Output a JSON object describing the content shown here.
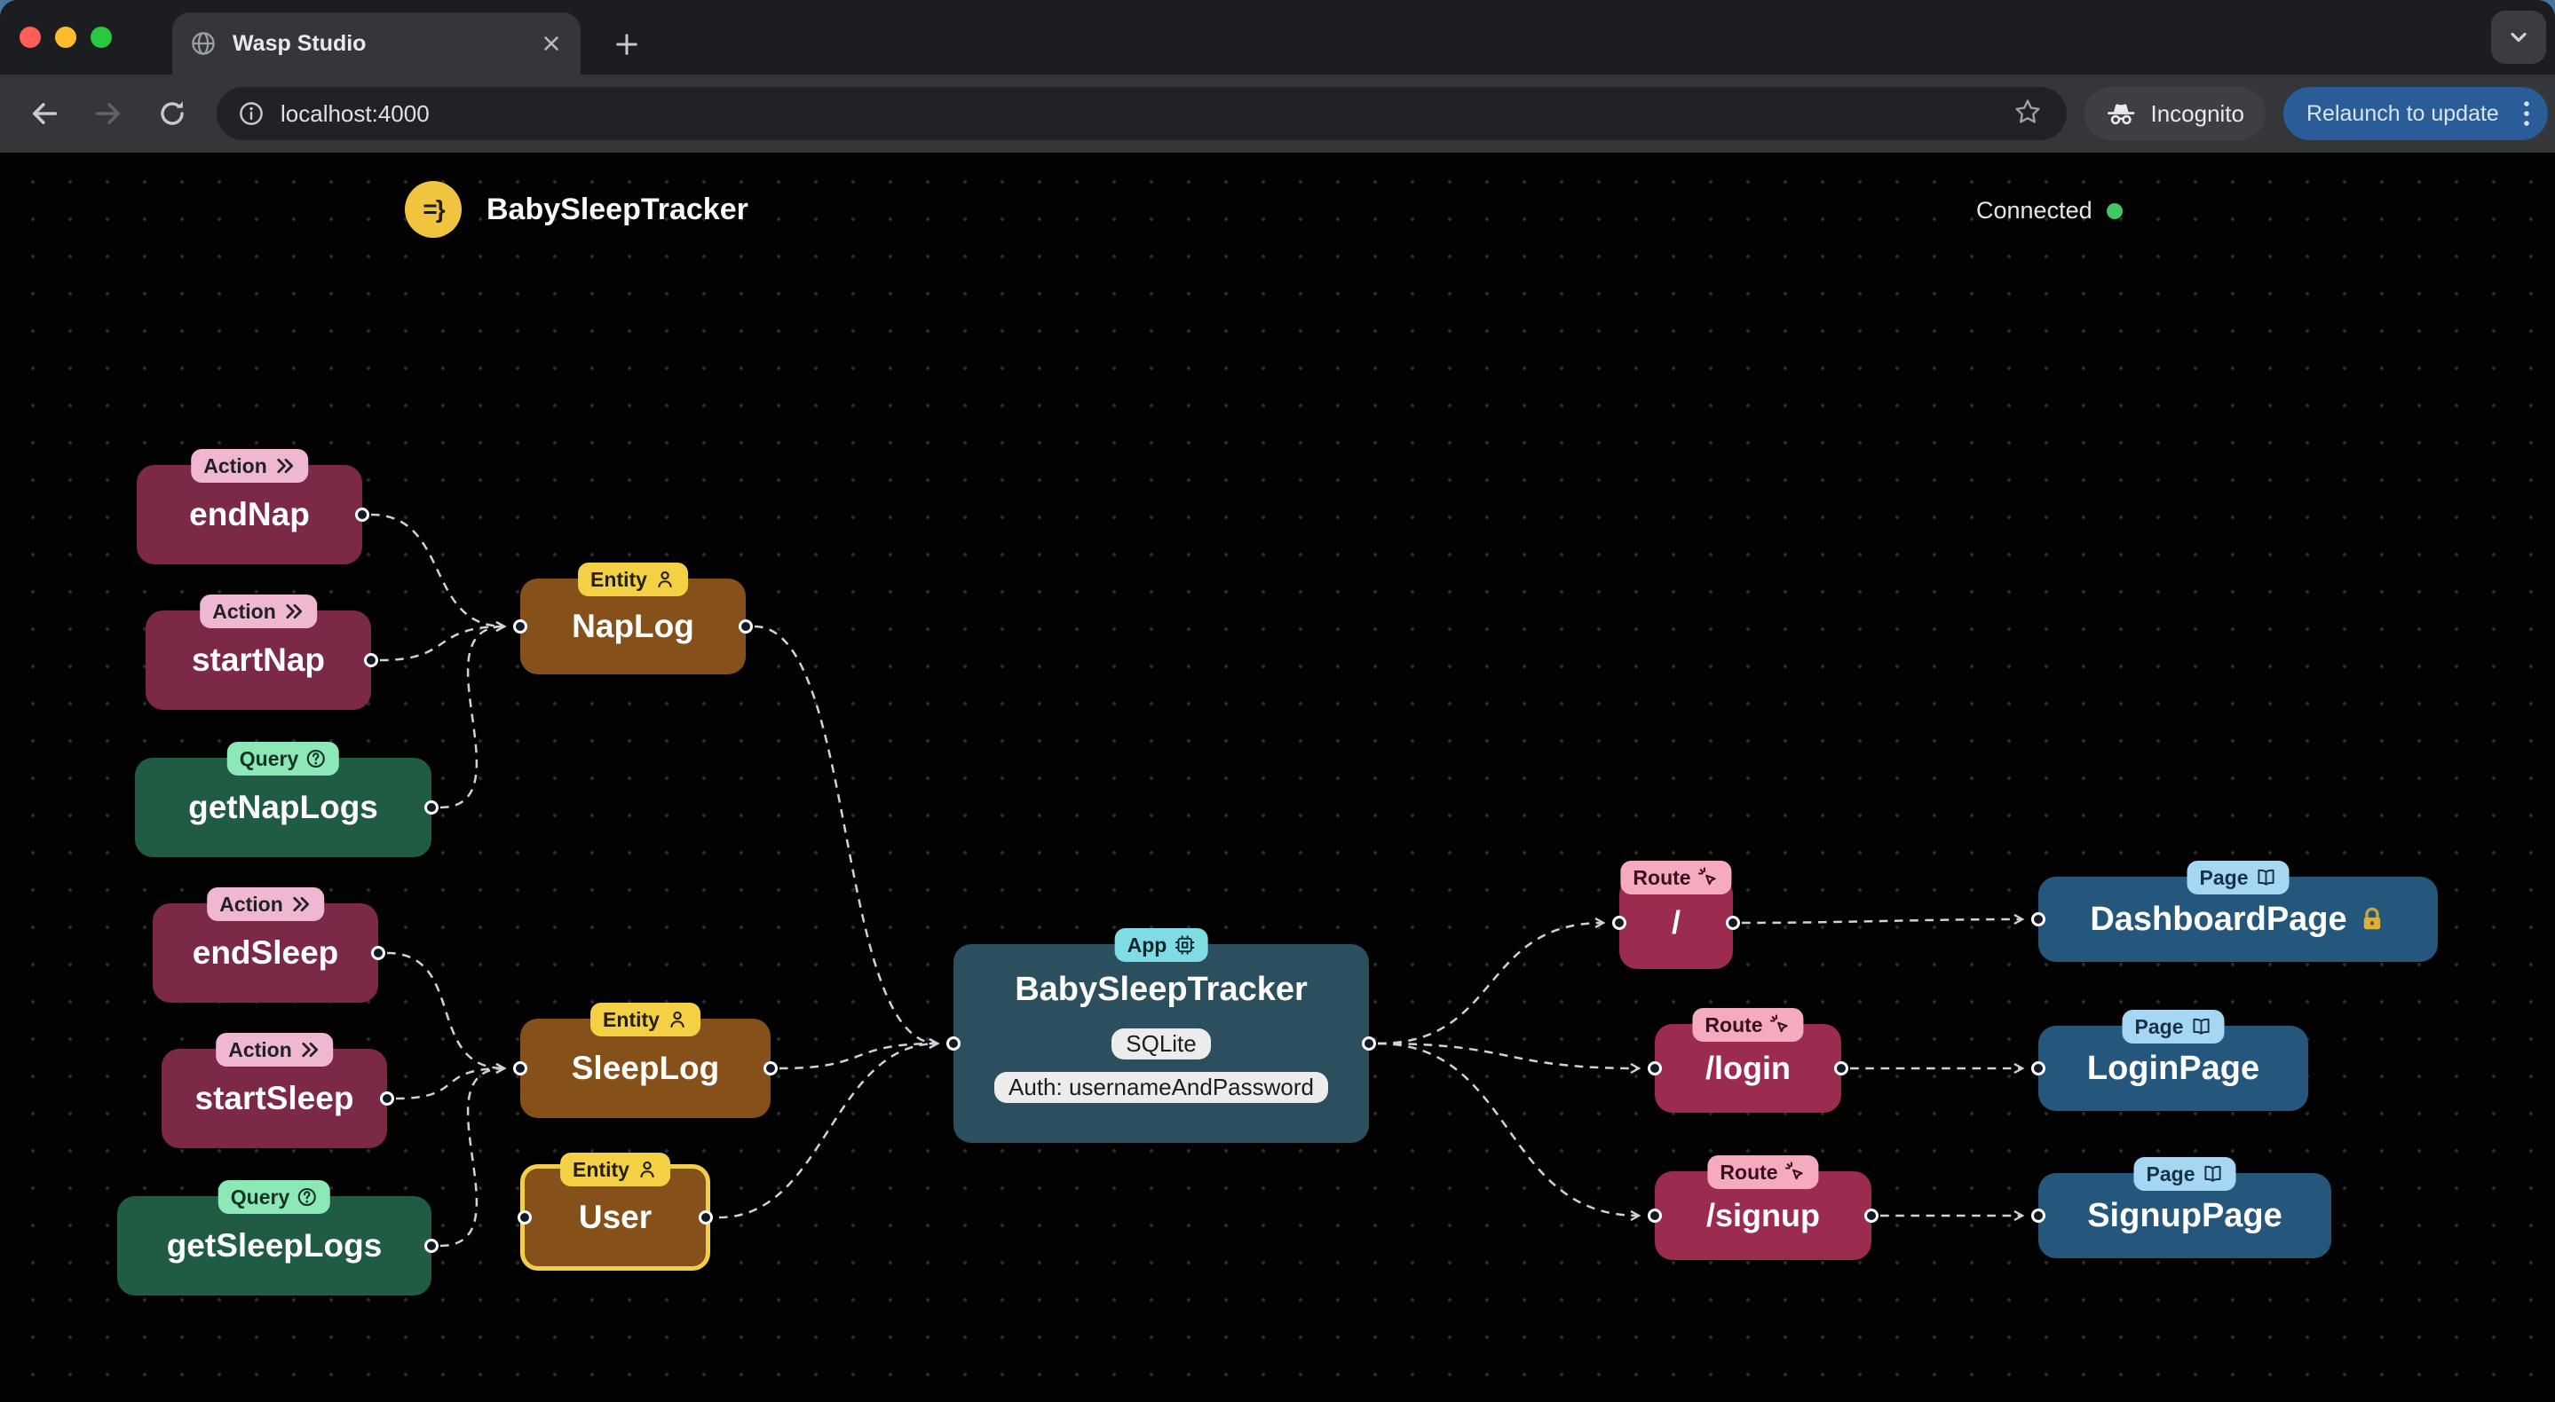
{
  "browser": {
    "tab_title": "Wasp Studio",
    "url": "localhost:4000",
    "incognito_label": "Incognito",
    "relaunch_label": "Relaunch to update"
  },
  "header": {
    "logo_glyph": "=}",
    "app_title": "BabySleepTracker",
    "status": "Connected",
    "status_color": "#43c666"
  },
  "diagram": {
    "colors": {
      "action_bg": "#7c2847",
      "action_badge": "#f0b7d2",
      "query_bg": "#1f5c43",
      "query_badge": "#8ce8b6",
      "entity_bg": "#855019",
      "entity_badge": "#f4d044",
      "app_bg": "#2c4f5e",
      "app_badge": "#7fdce4",
      "route_bg": "#9c2b50",
      "route_badge": "#f5abbd",
      "page_bg": "#25577d",
      "page_badge": "#a5d7f2",
      "edge": "#cfd2d6"
    },
    "nodes": [
      {
        "type": "action",
        "badge": "Action",
        "label": "endNap"
      },
      {
        "type": "action",
        "badge": "Action",
        "label": "startNap"
      },
      {
        "type": "query",
        "badge": "Query",
        "label": "getNapLogs"
      },
      {
        "type": "entity",
        "badge": "Entity",
        "label": "NapLog"
      },
      {
        "type": "action",
        "badge": "Action",
        "label": "endSleep"
      },
      {
        "type": "action",
        "badge": "Action",
        "label": "startSleep"
      },
      {
        "type": "query",
        "badge": "Query",
        "label": "getSleepLogs"
      },
      {
        "type": "entity",
        "badge": "Entity",
        "label": "SleepLog"
      },
      {
        "type": "entity",
        "badge": "Entity",
        "label": "User",
        "highlighted": true
      },
      {
        "type": "app",
        "badge": "App",
        "label": "BabySleepTracker",
        "db": "SQLite",
        "auth": "Auth: usernameAndPassword"
      },
      {
        "type": "route",
        "badge": "Route",
        "label": "/"
      },
      {
        "type": "route",
        "badge": "Route",
        "label": "/login"
      },
      {
        "type": "route",
        "badge": "Route",
        "label": "/signup"
      },
      {
        "type": "page",
        "badge": "Page",
        "label": "DashboardPage",
        "protected": true
      },
      {
        "type": "page",
        "badge": "Page",
        "label": "LoginPage"
      },
      {
        "type": "page",
        "badge": "Page",
        "label": "SignupPage"
      }
    ],
    "edges": [
      [
        "endNap",
        "NapLog"
      ],
      [
        "startNap",
        "NapLog"
      ],
      [
        "getNapLogs",
        "NapLog"
      ],
      [
        "endSleep",
        "SleepLog"
      ],
      [
        "startSleep",
        "SleepLog"
      ],
      [
        "getSleepLogs",
        "SleepLog"
      ],
      [
        "NapLog",
        "BabySleepTracker"
      ],
      [
        "SleepLog",
        "BabySleepTracker"
      ],
      [
        "User",
        "BabySleepTracker"
      ],
      [
        "BabySleepTracker",
        "/"
      ],
      [
        "BabySleepTracker",
        "/login"
      ],
      [
        "BabySleepTracker",
        "/signup"
      ],
      [
        "/",
        "DashboardPage"
      ],
      [
        "/login",
        "LoginPage"
      ],
      [
        "/signup",
        "SignupPage"
      ]
    ]
  }
}
